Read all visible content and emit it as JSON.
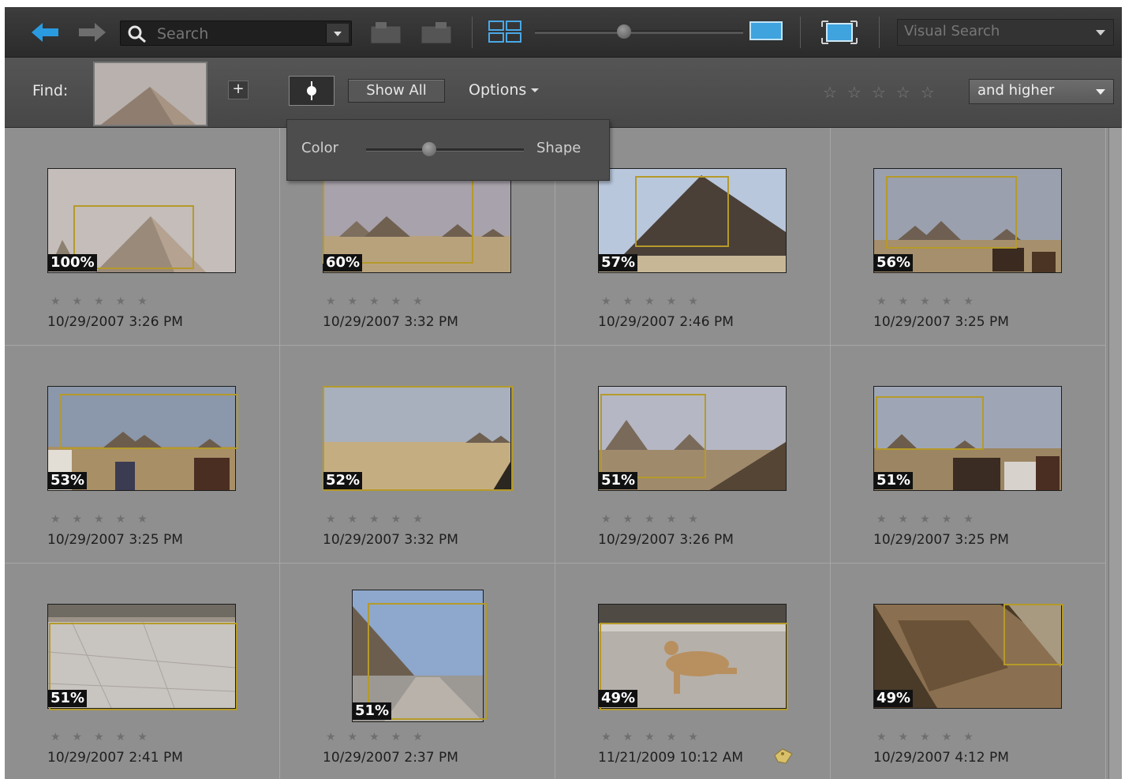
{
  "toolbar": {
    "search_placeholder": "Search",
    "view_mode": "Visual Search"
  },
  "findbar": {
    "find_label": "Find:",
    "add_button": "+",
    "show_all": "Show All",
    "options": "Options",
    "rating_stars": "☆☆☆☆☆",
    "rating_filter": "and higher"
  },
  "popup": {
    "left_label": "Color",
    "right_label": "Shape",
    "slider_fraction": 0.4
  },
  "thumbnails": [
    {
      "pct": "100%",
      "stars": "★★★★★",
      "date": "10/29/2007 3:26 PM"
    },
    {
      "pct": "60%",
      "stars": "★★★★★",
      "date": "10/29/2007 3:32 PM"
    },
    {
      "pct": "57%",
      "stars": "★★★★★",
      "date": "10/29/2007 2:46 PM"
    },
    {
      "pct": "56%",
      "stars": "★★★★★",
      "date": "10/29/2007 3:25 PM"
    },
    {
      "pct": "53%",
      "stars": "★★★★★",
      "date": "10/29/2007 3:25 PM"
    },
    {
      "pct": "52%",
      "stars": "★★★★★",
      "date": "10/29/2007 3:32 PM"
    },
    {
      "pct": "51%",
      "stars": "★★★★★",
      "date": "10/29/2007 3:26 PM"
    },
    {
      "pct": "51%",
      "stars": "★★★★★",
      "date": "10/29/2007 3:25 PM"
    },
    {
      "pct": "51%",
      "stars": "★★★★★",
      "date": "10/29/2007 2:41 PM"
    },
    {
      "pct": "51%",
      "stars": "★★★★★",
      "date": "10/29/2007 2:37 PM"
    },
    {
      "pct": "49%",
      "stars": "★★★★★",
      "date": "11/21/2009 10:12 AM"
    },
    {
      "pct": "49%",
      "stars": "★★★★★",
      "date": "10/29/2007 4:12 PM"
    }
  ]
}
